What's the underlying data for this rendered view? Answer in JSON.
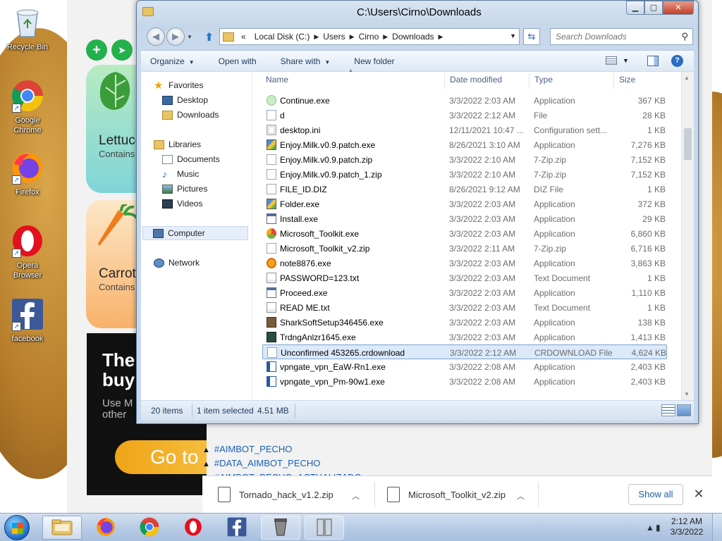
{
  "desktop": {
    "icons": [
      {
        "label": "Recycle Bin",
        "icon": "recycle-bin-icon"
      },
      {
        "label": "Google Chrome",
        "icon": "chrome-icon"
      },
      {
        "label": "Firefox",
        "icon": "firefox-icon"
      },
      {
        "label": "Opera Browser",
        "icon": "opera-icon"
      },
      {
        "label": "facebook",
        "icon": "facebook-icon"
      }
    ]
  },
  "browser": {
    "cards": [
      {
        "title": "Lettuce",
        "sub": "Contains"
      },
      {
        "title": "Carrot",
        "sub": "Contains"
      }
    ],
    "ad": {
      "headline_1": "The",
      "headline_2": "buy",
      "sub_1": "Use M",
      "sub_2": "other",
      "button": "Go to"
    },
    "links": [
      "#AIMBOT_PECHO",
      "#DATA_AIMBOT_PECHO",
      "#AIMBOT_PECHO_ACTUALIZADO"
    ],
    "downloads": {
      "items": [
        "Tornado_hack_v1.2.zip",
        "Microsoft_Toolkit_v2.zip"
      ],
      "show_all": "Show all"
    }
  },
  "explorer": {
    "title": "C:\\Users\\Cirno\\Downloads",
    "address": {
      "prefix": "«",
      "segments": [
        "Local Disk (C:)",
        "Users",
        "Cirno",
        "Downloads"
      ]
    },
    "search_placeholder": "Search Downloads",
    "commands": [
      "Organize",
      "Open with",
      "Share with",
      "New folder"
    ],
    "nav": {
      "favorites_label": "Favorites",
      "favorites": [
        "Desktop",
        "Downloads"
      ],
      "libraries_label": "Libraries",
      "libraries": [
        "Documents",
        "Music",
        "Pictures",
        "Videos"
      ],
      "computer": "Computer",
      "network": "Network"
    },
    "columns": {
      "name": "Name",
      "date": "Date modified",
      "type": "Type",
      "size": "Size"
    },
    "files": [
      {
        "name": "Continue.exe",
        "date": "3/3/2022 2:03 AM",
        "type": "Application",
        "size": "367 KB",
        "icon": "green-circle"
      },
      {
        "name": "d",
        "date": "3/3/2022 2:12 AM",
        "type": "File",
        "size": "28 KB",
        "icon": "blank"
      },
      {
        "name": "desktop.ini",
        "date": "12/11/2021 10:47 ...",
        "type": "Configuration sett...",
        "size": "1 KB",
        "icon": "config"
      },
      {
        "name": "Enjoy.Milk.v0.9.patch.exe",
        "date": "8/26/2021 3:10 AM",
        "type": "Application",
        "size": "7,276 KB",
        "icon": "installer"
      },
      {
        "name": "Enjoy.Milk.v0.9.patch.zip",
        "date": "3/3/2022 2:10 AM",
        "type": "7-Zip.zip",
        "size": "7,152 KB",
        "icon": "blank"
      },
      {
        "name": "Enjoy.Milk.v0.9.patch_1.zip",
        "date": "3/3/2022 2:10 AM",
        "type": "7-Zip.zip",
        "size": "7,152 KB",
        "icon": "blank"
      },
      {
        "name": "FILE_ID.DIZ",
        "date": "8/26/2021 9:12 AM",
        "type": "DIZ File",
        "size": "1 KB",
        "icon": "blank"
      },
      {
        "name": "Folder.exe",
        "date": "3/3/2022 2:03 AM",
        "type": "Application",
        "size": "372 KB",
        "icon": "installer"
      },
      {
        "name": "Install.exe",
        "date": "3/3/2022 2:03 AM",
        "type": "Application",
        "size": "29 KB",
        "icon": "app"
      },
      {
        "name": "Microsoft_Toolkit.exe",
        "date": "3/3/2022 2:03 AM",
        "type": "Application",
        "size": "6,860 KB",
        "icon": "office"
      },
      {
        "name": "Microsoft_Toolkit_v2.zip",
        "date": "3/3/2022 2:11 AM",
        "type": "7-Zip.zip",
        "size": "6,716 KB",
        "icon": "blank"
      },
      {
        "name": "note8876.exe",
        "date": "3/3/2022 2:03 AM",
        "type": "Application",
        "size": "3,863 KB",
        "icon": "orange-circle"
      },
      {
        "name": "PASSWORD=123.txt",
        "date": "3/3/2022 2:03 AM",
        "type": "Text Document",
        "size": "1 KB",
        "icon": "text"
      },
      {
        "name": "Proceed.exe",
        "date": "3/3/2022 2:03 AM",
        "type": "Application",
        "size": "1,110 KB",
        "icon": "app"
      },
      {
        "name": "READ ME.txt",
        "date": "3/3/2022 2:03 AM",
        "type": "Text Document",
        "size": "1 KB",
        "icon": "text"
      },
      {
        "name": "SharkSoftSetup346456.exe",
        "date": "3/3/2022 2:03 AM",
        "type": "Application",
        "size": "138 KB",
        "icon": "shark"
      },
      {
        "name": "TrdngAnlzr1645.exe",
        "date": "3/3/2022 2:03 AM",
        "type": "Application",
        "size": "1,413 KB",
        "icon": "dark-app"
      },
      {
        "name": "Unconfirmed 453265.crdownload",
        "date": "3/3/2022 2:12 AM",
        "type": "CRDOWNLOAD File",
        "size": "4,624 KB",
        "icon": "blank",
        "selected": true
      },
      {
        "name": "vpngate_vpn_EaW-Rn1.exe",
        "date": "3/3/2022 2:08 AM",
        "type": "Application",
        "size": "2,403 KB",
        "icon": "vpn"
      },
      {
        "name": "vpngate_vpn_Pm-90w1.exe",
        "date": "3/3/2022 2:08 AM",
        "type": "Application",
        "size": "2,403 KB",
        "icon": "vpn"
      }
    ],
    "status": {
      "items": "20 items",
      "selected": "1 item selected",
      "size": "4.51 MB"
    }
  },
  "taskbar": {
    "pinned": [
      "explorer-icon",
      "firefox-icon",
      "chrome-icon",
      "opera-icon",
      "facebook-icon",
      "coffee-icon",
      "archive-icon"
    ],
    "clock_time": "2:12 AM",
    "clock_date": "3/3/2022"
  }
}
